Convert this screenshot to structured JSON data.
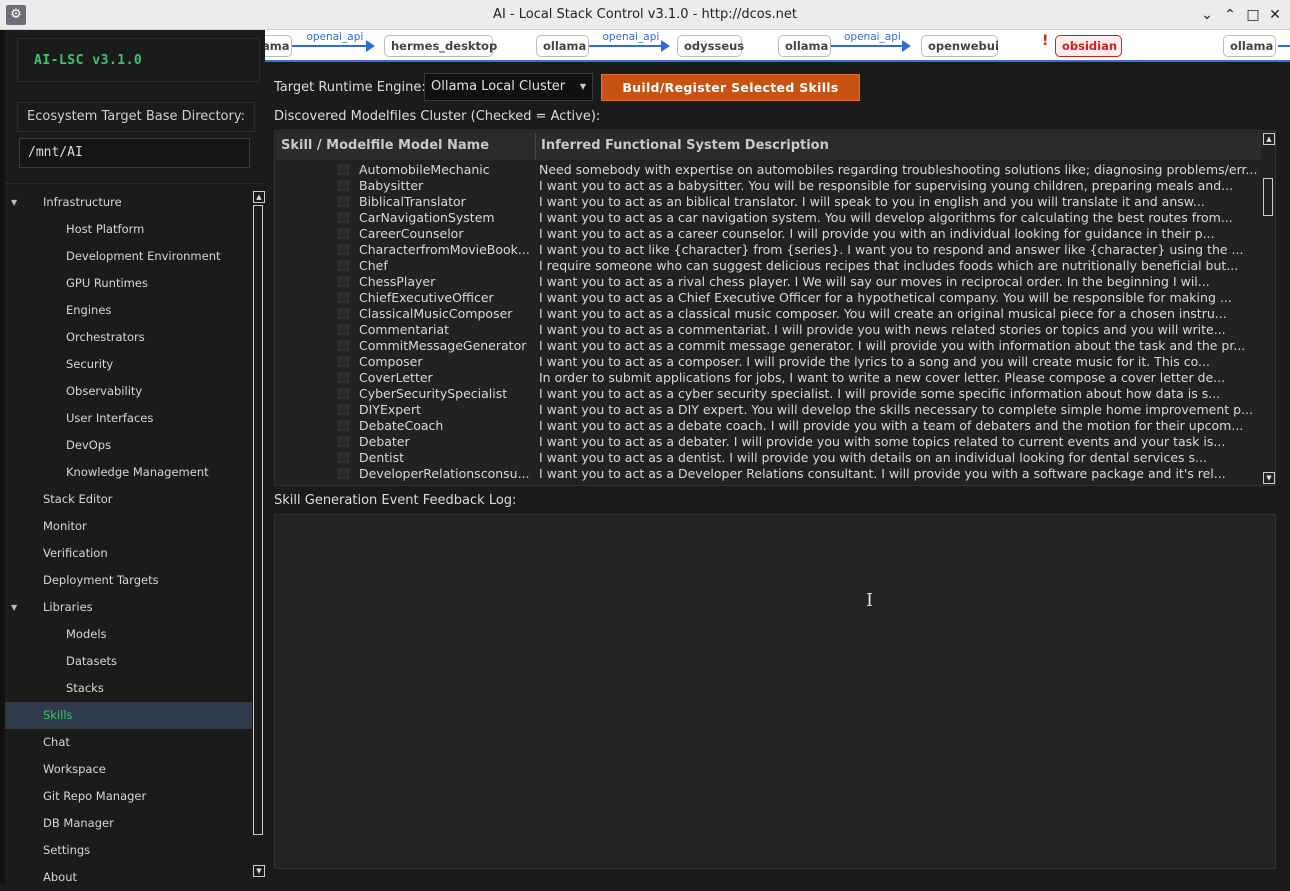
{
  "window": {
    "title": "AI - Local Stack Control v3.1.0 - http://dcos.net",
    "controls": [
      "⌄",
      "⌃",
      "□",
      "✕"
    ]
  },
  "sidebar": {
    "brand": "AI-LSC v3.1.0",
    "base_dir_label": "Ecosystem Target Base Directory:",
    "base_dir_value": "/mnt/AI",
    "items": [
      {
        "label": "Infrastructure",
        "level": 0,
        "expander": true
      },
      {
        "label": "Host Platform",
        "level": 1
      },
      {
        "label": "Development Environment",
        "level": 1
      },
      {
        "label": "GPU Runtimes",
        "level": 1
      },
      {
        "label": "Engines",
        "level": 1
      },
      {
        "label": "Orchestrators",
        "level": 1
      },
      {
        "label": "Security",
        "level": 1
      },
      {
        "label": "Observability",
        "level": 1
      },
      {
        "label": "User Interfaces",
        "level": 1
      },
      {
        "label": "DevOps",
        "level": 1
      },
      {
        "label": "Knowledge Management",
        "level": 1
      },
      {
        "label": "Stack Editor",
        "level": 0
      },
      {
        "label": "Monitor",
        "level": 0
      },
      {
        "label": "Verification",
        "level": 0
      },
      {
        "label": "Deployment Targets",
        "level": 0
      },
      {
        "label": "Libraries",
        "level": 0,
        "expander": true
      },
      {
        "label": "Models",
        "level": 1
      },
      {
        "label": "Datasets",
        "level": 1
      },
      {
        "label": "Stacks",
        "level": 1
      },
      {
        "label": "Skills",
        "level": 0,
        "active": true
      },
      {
        "label": "Chat",
        "level": 0
      },
      {
        "label": "Workspace",
        "level": 0
      },
      {
        "label": "Git Repo Manager",
        "level": 0
      },
      {
        "label": "DB Manager",
        "level": 0
      },
      {
        "label": "Settings",
        "level": 0
      },
      {
        "label": "About",
        "level": 0
      }
    ]
  },
  "pipeline": {
    "nodes": [
      "ama",
      "hermes_desktop",
      "ollama",
      "odysseus",
      "ollama",
      "openwebui",
      "obsidian",
      "ollama"
    ],
    "edge_label": "openai_api",
    "warning_mark": "!"
  },
  "main": {
    "engine_label": "Target Runtime Engine:",
    "engine_value": "Ollama Local Cluster",
    "build_button": "Build/Register Selected Skills",
    "cluster_label": "Discovered Modelfiles Cluster (Checked = Active):",
    "table": {
      "columns": [
        "Skill / Modelfile Model Name",
        "Inferred Functional System Description"
      ],
      "rows": [
        {
          "name": "AutomobileMechanic",
          "desc": "Need somebody with expertise on automobiles regarding troubleshooting solutions like; diagnosing problems/err..."
        },
        {
          "name": "Babysitter",
          "desc": "I want you to act as a babysitter. You will be responsible for supervising young children, preparing meals and..."
        },
        {
          "name": "BiblicalTranslator",
          "desc": "I want you to act as an biblical translator. I will speak to you in english and you will translate it and answ..."
        },
        {
          "name": "CarNavigationSystem",
          "desc": "I want you to act as a car navigation system. You will develop algorithms for calculating the best routes from..."
        },
        {
          "name": "CareerCounselor",
          "desc": "I want you to act as a career counselor. I will provide you with an individual looking for guidance in their p..."
        },
        {
          "name": "CharacterfromMovieBook...",
          "desc": "I want you to act like {character} from {series}. I want you to respond and answer like {character} using the ..."
        },
        {
          "name": "Chef",
          "desc": "I require someone who can suggest delicious recipes that includes foods which are nutritionally beneficial but..."
        },
        {
          "name": "ChessPlayer",
          "desc": "I want you to act as a rival chess player. I We will say our moves in reciprocal order. In the beginning I wil..."
        },
        {
          "name": "ChiefExecutiveOfficer",
          "desc": "I want you to act as a Chief Executive Officer for a hypothetical company. You will be responsible for making ..."
        },
        {
          "name": "ClassicalMusicComposer",
          "desc": "I want you to act as a classical music composer. You will create an original musical piece for a chosen instru..."
        },
        {
          "name": "Commentariat",
          "desc": "I want you to act as a commentariat. I will provide you with news related stories or topics and you will write..."
        },
        {
          "name": "CommitMessageGenerator",
          "desc": "I want you to act as a commit message generator. I will provide you with information about the task and the pr..."
        },
        {
          "name": "Composer",
          "desc": "I want you to act as a composer. I will provide the lyrics to a song and you will create music for it. This co..."
        },
        {
          "name": "CoverLetter",
          "desc": "In order to submit applications for jobs, I want to write a new cover letter. Please compose a cover letter de..."
        },
        {
          "name": "CyberSecuritySpecialist",
          "desc": "I want you to act as a cyber security specialist. I will provide some specific information about how data is s..."
        },
        {
          "name": "DIYExpert",
          "desc": "I want you to act as a DIY expert. You will develop the skills necessary to complete simple home improvement p..."
        },
        {
          "name": "DebateCoach",
          "desc": "I want you to act as a debate coach. I will provide you with a team of debaters and the motion for their upcom..."
        },
        {
          "name": "Debater",
          "desc": "I want you to act as a debater. I will provide you with some topics related to current events and your task is..."
        },
        {
          "name": "Dentist",
          "desc": "I want you to act as a dentist. I will provide you with details on an individual looking for dental services s..."
        },
        {
          "name": "DeveloperRelationsconsu...",
          "desc": "I want you to act as a Developer Relations consultant. I will provide you with a software package and it's rel..."
        }
      ]
    },
    "log_label": "Skill Generation Event Feedback Log:"
  }
}
